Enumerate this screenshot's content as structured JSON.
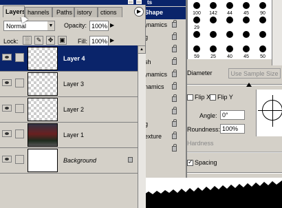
{
  "brushes_panel": {
    "title": "ts",
    "items": [
      {
        "label": "Shape",
        "selected": true,
        "lock": false
      },
      {
        "label": "ynamics",
        "selected": false,
        "lock": true
      },
      {
        "label": "g",
        "selected": false,
        "lock": true
      },
      {
        "label": "",
        "selected": false,
        "lock": true
      },
      {
        "label": "sh",
        "selected": false,
        "lock": true
      },
      {
        "label": "ynamics",
        "selected": false,
        "lock": true
      },
      {
        "label": "namics",
        "selected": false,
        "lock": true
      },
      {
        "label": "",
        "selected": false,
        "lock": true
      },
      {
        "label": "",
        "selected": false,
        "lock": true
      },
      {
        "label": "g",
        "selected": false,
        "lock": true
      },
      {
        "label": "exture",
        "selected": false,
        "lock": true
      },
      {
        "label": "",
        "selected": false,
        "lock": true
      }
    ],
    "presets": [
      "100",
      "142",
      "44",
      "45",
      "90",
      "29",
      "",
      "",
      "",
      "",
      "",
      "",
      "",
      "",
      "",
      "59",
      "25",
      "40",
      "45",
      "50"
    ],
    "diameter_label": "Diameter",
    "sample_button": "Use Sample Size",
    "flip_x": "Flip X",
    "flip_y": "Flip Y",
    "angle_label": "Angle:",
    "angle_value": "0°",
    "roundness_label": "Roundness:",
    "roundness_value": "100%",
    "hardness_label": "Hardness",
    "spacing_label": "Spacing",
    "spacing_checked": true
  },
  "layers_panel": {
    "tabs": [
      "Layers",
      "hannels",
      "Paths",
      "istory",
      "ctions"
    ],
    "blend_mode": "Normal",
    "opacity_label": "Opacity:",
    "opacity_value": "100%",
    "lock_label": "Lock:",
    "fill_label": "Fill:",
    "fill_value": "100%",
    "layers": [
      {
        "name": "Layer 4",
        "selected": true,
        "thumb": "transparent"
      },
      {
        "name": "Layer 3",
        "selected": false,
        "thumb": "transparent"
      },
      {
        "name": "Layer 2",
        "selected": false,
        "thumb": "transparent"
      },
      {
        "name": "Layer 1",
        "selected": false,
        "thumb": "photo"
      },
      {
        "name": "Background",
        "selected": false,
        "thumb": "white"
      }
    ]
  },
  "colors": {
    "selection": "#0a246a",
    "panel": "#d4d0c8"
  }
}
